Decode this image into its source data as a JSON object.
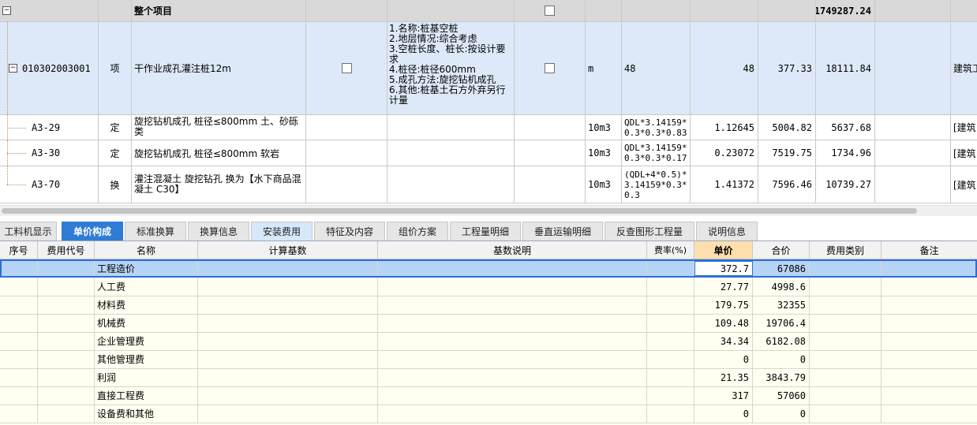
{
  "top_grid": {
    "header_row": {
      "name": "整个项目",
      "total": "1749287.24"
    },
    "main_item": {
      "code": "010302003001",
      "type": "项",
      "name": "干作业成孔灌注桩12m",
      "features": [
        "1.名称:桩基空桩",
        "2.地层情况:综合考虑",
        "3.空桩长度、桩长:按设计要",
        "求",
        "4.桩径:桩径600mm",
        "5.成孔方法:旋挖钻机成孔",
        "6.其他:桩基土石方外弃另行",
        "计量"
      ],
      "unit": "m",
      "quantity_expr": "48",
      "quantity": "48",
      "unit_price": "377.33",
      "total": "18111.84",
      "category": "建筑工"
    },
    "sub_items": [
      {
        "code": "A3-29",
        "type": "定",
        "name": "旋挖钻机成孔 桩径≤800mm 土、砂砾类",
        "unit": "10m3",
        "expr": "QDL*3.14159*0.3*0.3*0.83",
        "quantity": "1.12645",
        "unit_price": "5004.82",
        "total": "5637.68",
        "category": "[建筑"
      },
      {
        "code": "A3-30",
        "type": "定",
        "name": "旋挖钻机成孔 桩径≤800mm 软岩",
        "unit": "10m3",
        "expr": "QDL*3.14159*0.3*0.3*0.17",
        "quantity": "0.23072",
        "unit_price": "7519.75",
        "total": "1734.96",
        "category": "[建筑"
      },
      {
        "code": "A3-70",
        "type": "换",
        "name": "灌注混凝土 旋挖钻孔  换为【水下商品混凝土 C30】",
        "unit": "10m3",
        "expr": "(QDL+4*0.5)*3.14159*0.3*0.3",
        "quantity": "1.41372",
        "unit_price": "7596.46",
        "total": "10739.27",
        "category": "[建筑"
      }
    ]
  },
  "tabs": [
    "工料机显示",
    "单价构成",
    "标准换算",
    "换算信息",
    "安装费用",
    "特征及内容",
    "组价方案",
    "工程量明细",
    "垂直运输明细",
    "反查图形工程量",
    "说明信息"
  ],
  "active_tab": "单价构成",
  "cost_table": {
    "columns": [
      "序号",
      "费用代号",
      "名称",
      "计算基数",
      "基数说明",
      "费率(%)",
      "单价",
      "合价",
      "费用类别",
      "备注"
    ],
    "rows": [
      {
        "name": "工程造价",
        "price": "372.7",
        "total": "67086"
      },
      {
        "name": "人工费",
        "price": "27.77",
        "total": "4998.6"
      },
      {
        "name": "材料费",
        "price": "179.75",
        "total": "32355"
      },
      {
        "name": "机械费",
        "price": "109.48",
        "total": "19706.4"
      },
      {
        "name": "企业管理费",
        "price": "34.34",
        "total": "6182.08"
      },
      {
        "name": "其他管理费",
        "price": "0",
        "total": "0"
      },
      {
        "name": "利润",
        "price": "21.35",
        "total": "3843.79"
      },
      {
        "name": "直接工程费",
        "price": "317",
        "total": "57060"
      },
      {
        "name": "设备费和其他",
        "price": "0",
        "total": "0"
      }
    ]
  },
  "colors": {
    "active_tab": "#2f7bd6",
    "selected_row": "#b6d4f5",
    "price_header": "#ffdfae",
    "grid_bg": "#fffef0"
  }
}
